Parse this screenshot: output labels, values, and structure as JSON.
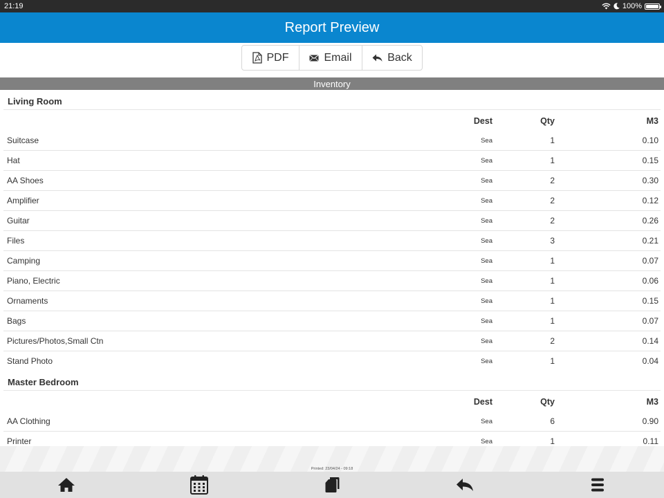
{
  "status": {
    "time": "21:19",
    "battery": "100%",
    "battery_level": 100
  },
  "header": {
    "title": "Report Preview"
  },
  "toolbar": {
    "pdf_label": "PDF",
    "email_label": "Email",
    "back_label": "Back"
  },
  "section": {
    "title": "Inventory"
  },
  "columns": {
    "dest": "Dest",
    "qty": "Qty",
    "m3": "M3"
  },
  "rooms": [
    {
      "name": "Living Room",
      "items": [
        {
          "name": "Suitcase",
          "dest": "Sea",
          "qty": "1",
          "m3": "0.10"
        },
        {
          "name": "Hat",
          "dest": "Sea",
          "qty": "1",
          "m3": "0.15"
        },
        {
          "name": "AA Shoes",
          "dest": "Sea",
          "qty": "2",
          "m3": "0.30"
        },
        {
          "name": "Amplifier",
          "dest": "Sea",
          "qty": "2",
          "m3": "0.12"
        },
        {
          "name": "Guitar",
          "dest": "Sea",
          "qty": "2",
          "m3": "0.26"
        },
        {
          "name": "Files",
          "dest": "Sea",
          "qty": "3",
          "m3": "0.21"
        },
        {
          "name": "Camping",
          "dest": "Sea",
          "qty": "1",
          "m3": "0.07"
        },
        {
          "name": "Piano, Electric",
          "dest": "Sea",
          "qty": "1",
          "m3": "0.06"
        },
        {
          "name": "Ornaments",
          "dest": "Sea",
          "qty": "1",
          "m3": "0.15"
        },
        {
          "name": "Bags",
          "dest": "Sea",
          "qty": "1",
          "m3": "0.07"
        },
        {
          "name": "Pictures/Photos,Small Ctn",
          "dest": "Sea",
          "qty": "2",
          "m3": "0.14"
        },
        {
          "name": "Stand Photo",
          "dest": "Sea",
          "qty": "1",
          "m3": "0.04"
        }
      ]
    },
    {
      "name": "Master Bedroom",
      "items": [
        {
          "name": "AA Clothing",
          "dest": "Sea",
          "qty": "6",
          "m3": "0.90"
        },
        {
          "name": "Printer",
          "dest": "Sea",
          "qty": "1",
          "m3": "0.11"
        }
      ]
    }
  ],
  "footer": {
    "printed": "Printed: 23/04/24 - 09:18"
  },
  "nav": {
    "icons": [
      "home-icon",
      "calendar-icon",
      "documents-icon",
      "back-arrow-icon",
      "menu-icon"
    ]
  },
  "colors": {
    "title_bar": "#0a86cf",
    "section_bar": "#808080",
    "status_bar": "#2b2b2b",
    "nav_bar": "#e1e1e1"
  }
}
